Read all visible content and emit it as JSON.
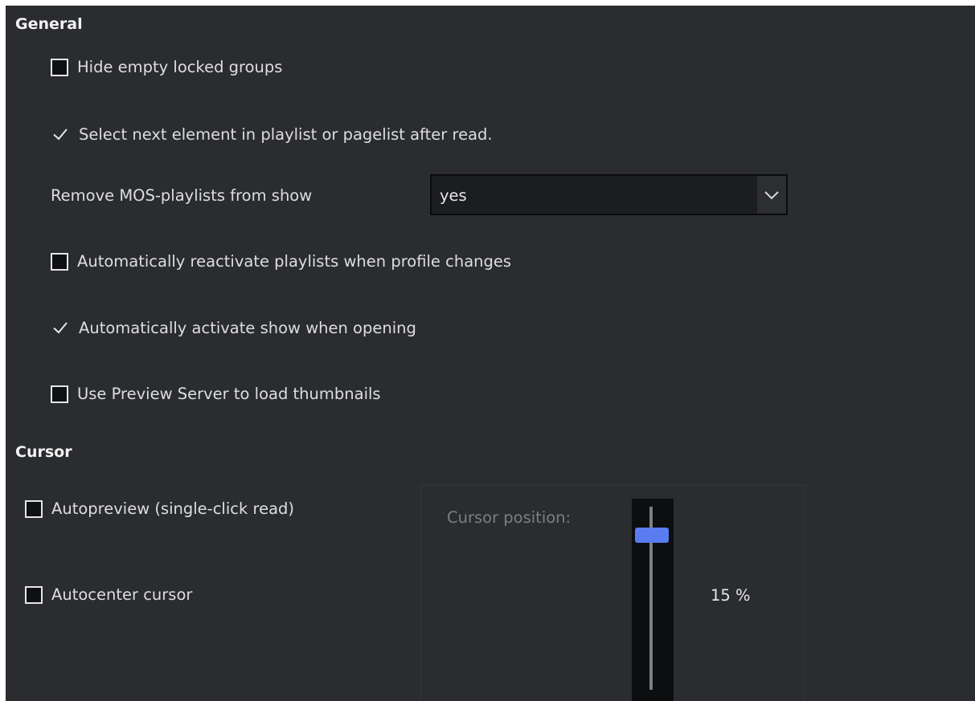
{
  "general": {
    "title": "General",
    "options": [
      {
        "label": "Hide empty locked groups",
        "checked": false
      },
      {
        "label": "Select next element in playlist or pagelist after read.",
        "checked": true
      },
      {
        "label": "Automatically reactivate playlists when profile changes",
        "checked": false
      },
      {
        "label": "Automatically activate show when opening",
        "checked": true
      },
      {
        "label": "Use Preview Server to load thumbnails",
        "checked": false
      }
    ],
    "remove_mos": {
      "label": "Remove MOS-playlists from show",
      "value": "yes",
      "icon": "chevron-down-icon"
    }
  },
  "cursor": {
    "title": "Cursor",
    "options": [
      {
        "label": "Autopreview (single-click read)",
        "checked": false
      },
      {
        "label": "Autocenter cursor",
        "checked": false
      }
    ],
    "position": {
      "label": "Cursor position:",
      "value_text": "15 %",
      "value": 0.15
    }
  },
  "colors": {
    "background": "#2a2c2f",
    "slider_handle": "#5b7bf0",
    "checkbox_fill": "#0f1012"
  }
}
